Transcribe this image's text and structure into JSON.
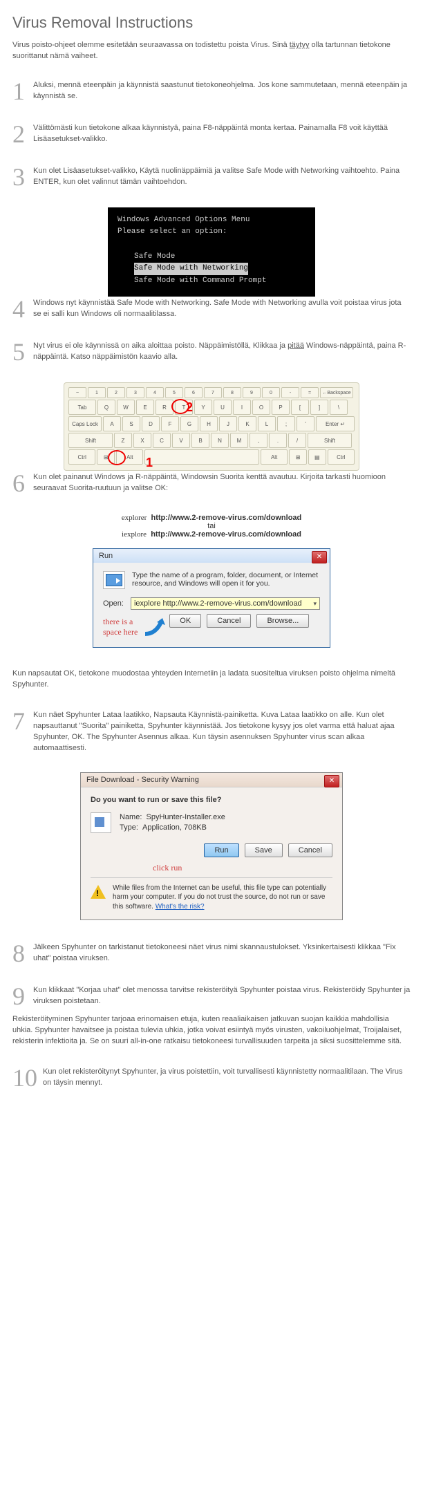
{
  "title": "Virus Removal Instructions",
  "intro_a": "Virus poisto-ohjeet olemme esitetään seuraavassa on todistettu poista Virus. Sinä ",
  "intro_u": "täytyy",
  "intro_b": " olla tartunnan tietokone suorittanut nämä vaiheet.",
  "steps": {
    "s1": {
      "n": "1",
      "t": "Aluksi, mennä eteenpäin ja käynnistä saastunut tietokoneohjelma. Jos kone sammutetaan, mennä eteenpäin ja käynnistä se."
    },
    "s2": {
      "n": "2",
      "t": "Välittömästi kun tietokone alkaa käynnistyä, paina F8-näppäintä monta kertaa. Painamalla F8 voit käyttää Lisäasetukset-valikko."
    },
    "s3": {
      "n": "3",
      "t": "Kun olet Lisäasetukset-valikko, Käytä nuolinäppäimiä ja valitse Safe Mode with Networking vaihtoehto. Paina ENTER, kun olet valinnut tämän vaihtoehdon."
    },
    "s4": {
      "n": "4",
      "t": "Windows nyt käynnistää Safe Mode with Networking. Safe Mode with Networking avulla voit poistaa virus jota se ei salli kun Windows oli normaalitilassa."
    },
    "s5": {
      "n": "5",
      "ta": "Nyt virus ei ole käynnissä on aika aloittaa poisto. Näppäimistöllä, Klikkaa ja ",
      "tu": "pitää",
      "tb": " Windows-näppäintä, paina R-näppäintä. Katso näppäimistön kaavio alla."
    },
    "s6": {
      "n": "6",
      "t": "Kun olet painanut Windows ja R-näppäintä, Windowsin Suorita kenttä avautuu. Kirjoita tarkasti huomioon seuraavat Suorita-ruutuun ja valitse OK:"
    },
    "s7": {
      "n": "7",
      "t": "Kun näet Spyhunter Lataa laatikko, Napsauta Käynnistä-painiketta. Kuva Lataa laatikko on alle. Kun olet napsauttanut \"Suorita\" painiketta, Spyhunter käynnistää. Jos tietokone kysyy jos olet varma että haluat ajaa Spyhunter, OK. The Spyhunter Asennus alkaa. Kun täysin asennuksen Spyhunter virus scan alkaa automaattisesti."
    },
    "s8": {
      "n": "8",
      "t": "Jälkeen Spyhunter on tarkistanut tietokoneesi näet virus nimi skannaustulokset. Yksinkertaisesti klikkaa \"Fix uhat\" poistaa viruksen."
    },
    "s9": {
      "n": "9",
      "t": "Kun klikkaat \"Korjaa uhat\" olet menossa tarvitse rekisteröityä Spyhunter poistaa virus. Rekisteröidy Spyhunter ja viruksen poistetaan."
    },
    "s10": {
      "n": "10",
      "t": "Kun olet rekisteröitynyt Spyhunter, ja virus poistettiin, voit turvallisesti käynnistetty normaalitilaan. The Virus on täysin mennyt."
    }
  },
  "dos": {
    "l1": "Windows Advanced Options Menu",
    "l2": "Please select an option:",
    "o1": "Safe Mode",
    "o2": "Safe Mode with Networking",
    "o3": "Safe Mode with Command Prompt"
  },
  "kb": {
    "m1": "1",
    "m2": "2",
    "backspace": "←Backspace",
    "tab": "Tab",
    "caps": "Caps Lock",
    "enter": "Enter",
    "shiftL": "Shift",
    "shiftR": "Shift",
    "ctrl": "Ctrl",
    "alt": "Alt",
    "win": "⊞",
    "r1": [
      "~",
      "1",
      "2",
      "3",
      "4",
      "5",
      "6",
      "7",
      "8",
      "9",
      "0",
      "-",
      "="
    ],
    "r2": [
      "Q",
      "W",
      "E",
      "R",
      "T",
      "Y",
      "U",
      "I",
      "O",
      "P",
      "[",
      "]",
      "\\"
    ],
    "r3": [
      "A",
      "S",
      "D",
      "F",
      "G",
      "H",
      "J",
      "K",
      "L",
      ";",
      "'"
    ],
    "r4": [
      "Z",
      "X",
      "C",
      "V",
      "B",
      "N",
      "M",
      ",",
      ".",
      "/"
    ]
  },
  "cmd": {
    "l1a": "explorer",
    "l1b": "http://www.2-remove-virus.com/download",
    "mid": "tai",
    "l2a": "iexplore",
    "l2b": "http://www.2-remove-virus.com/download"
  },
  "run": {
    "title": "Run",
    "desc": "Type the name of a program, folder, document, or Internet resource, and Windows will open it for you.",
    "open": "Open:",
    "value": "iexplore  http://www.2-remove-virus.com/download",
    "hint1": "there is a",
    "hint2": "space here",
    "ok": "OK",
    "cancel": "Cancel",
    "browse": "Browse..."
  },
  "mid_para": "Kun napsautat OK, tietokone muodostaa yhteyden Internetiin ja ladata suositeltua viruksen poisto ohjelma nimeltä Spyhunter.",
  "dl": {
    "title": "File Download - Security Warning",
    "q": "Do you want to run or save this file?",
    "name_l": "Name:",
    "name_v": "SpyHunter-Installer.exe",
    "type_l": "Type:",
    "type_v": "Application, 708KB",
    "run": "Run",
    "save": "Save",
    "cancel": "Cancel",
    "hint": "click run",
    "warn": "While files from the Internet can be useful, this file type can potentially harm your computer. If you do not trust the source, do not run or save this software. ",
    "risk": "What's the risk?"
  },
  "para9": "Rekisteröityminen Spyhunter tarjoaa erinomaisen etuja, kuten reaaliaikaisen jatkuvan suojan kaikkia mahdollisia uhkia. Spyhunter havaitsee ja poistaa tulevia uhkia, jotka voivat esiintyä myös virusten, vakoiluohjelmat, Troijalaiset, rekisterin infektioita ja. Se on suuri all-in-one ratkaisu tietokoneesi turvallisuuden tarpeita ja siksi suosittelemme sitä."
}
